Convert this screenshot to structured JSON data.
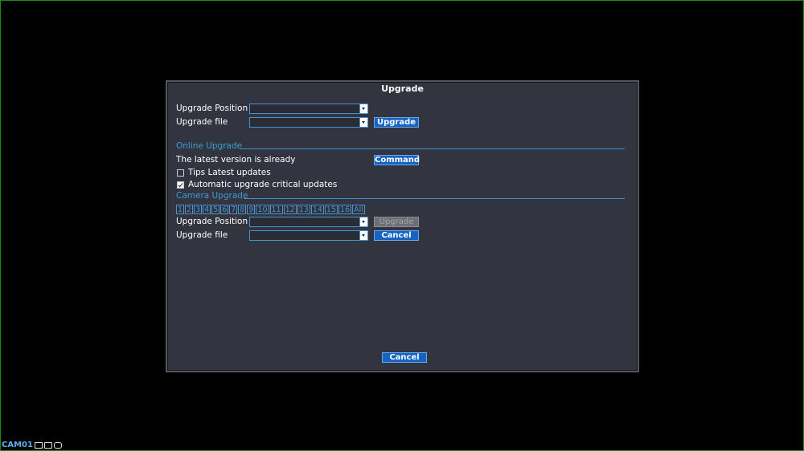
{
  "dialog": {
    "title": "Upgrade",
    "upgrade_position_label": "Upgrade Position",
    "upgrade_file_label": "Upgrade file",
    "upgrade_position_value": "",
    "upgrade_file_value": "",
    "upgrade_button": "Upgrade",
    "online": {
      "section_title": "Online Upgrade",
      "status_text": "The latest version is already",
      "command_button": "Command",
      "tips_label": "Tips Latest updates",
      "tips_checked": false,
      "auto_label": "Automatic upgrade critical updates",
      "auto_checked": true
    },
    "camera": {
      "section_title": "Camera Upgrade",
      "channels": [
        "1",
        "2",
        "3",
        "4",
        "5",
        "6",
        "7",
        "8",
        "9",
        "10",
        "11",
        "12",
        "13",
        "14",
        "15",
        "16",
        "All"
      ],
      "upgrade_position_label": "Upgrade Position",
      "upgrade_file_label": "Upgrade file",
      "upgrade_position_value": "",
      "upgrade_file_value": "",
      "upgrade_button": "Upgrade",
      "cancel_button": "Cancel"
    },
    "cancel_button": "Cancel"
  },
  "statusbar": {
    "camera_name": "CAM01",
    "icons": [
      "record-icon",
      "audio-mute-icon",
      "camera-icon"
    ]
  },
  "colors": {
    "accent": "#3e9bd9",
    "button": "#1564c4",
    "dialog_bg": "#32343f",
    "screen_border": "#1e8a1e"
  }
}
